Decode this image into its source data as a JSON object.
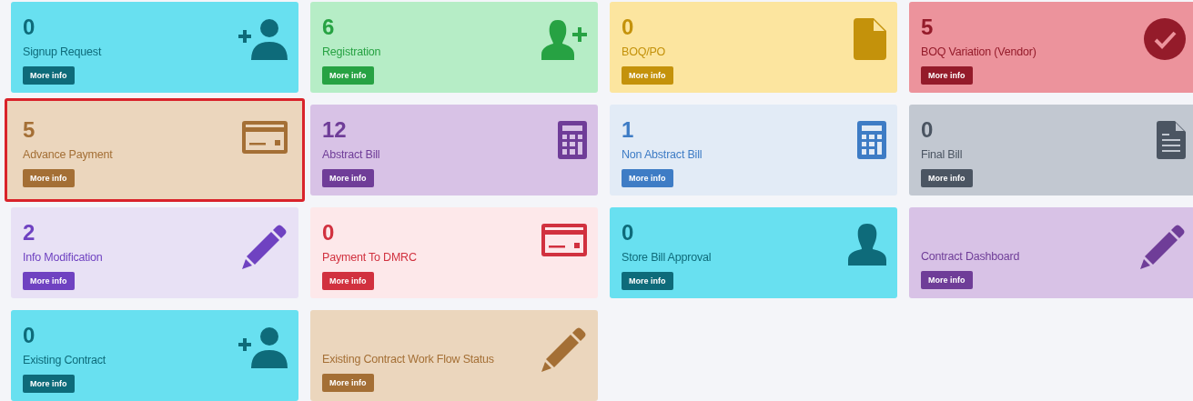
{
  "tiles": [
    {
      "count": "0",
      "label": "Signup Request",
      "button": "More info",
      "color": "#0e6b7a",
      "kind": "user-plus-left",
      "highlighted": false
    },
    {
      "count": "6",
      "label": "Registration",
      "button": "More info",
      "color": "#27a243",
      "kind": "user-plus-right",
      "highlighted": false
    },
    {
      "count": "0",
      "label": "BOQ/PO",
      "button": "More info",
      "color": "#c4920b",
      "kind": "file",
      "highlighted": false
    },
    {
      "count": "5",
      "label": "BOQ Variation (Vendor)",
      "button": "More info",
      "color": "#941b2a",
      "kind": "check-circle",
      "highlighted": false
    },
    {
      "count": "5",
      "label": "Advance Payment",
      "button": "More info",
      "color": "#a46f35",
      "kind": "card",
      "highlighted": true
    },
    {
      "count": "12",
      "label": "Abstract Bill",
      "button": "More info",
      "color": "#6f3d98",
      "kind": "calculator",
      "highlighted": false
    },
    {
      "count": "1",
      "label": "Non Abstract Bill",
      "button": "More info",
      "color": "#3e7cc5",
      "kind": "calculator",
      "highlighted": false
    },
    {
      "count": "0",
      "label": "Final Bill",
      "button": "More info",
      "color": "#4b5562",
      "kind": "document",
      "highlighted": false
    },
    {
      "count": "2",
      "label": "Info Modification",
      "button": "More info",
      "color": "#6f42c1",
      "kind": "pencil",
      "highlighted": false
    },
    {
      "count": "0",
      "label": "Payment To DMRC",
      "button": "More info",
      "color": "#d1313f",
      "kind": "card",
      "highlighted": false
    },
    {
      "count": "0",
      "label": "Store Bill Approval",
      "button": "More info",
      "color": "#0e6b7a",
      "kind": "user",
      "highlighted": false
    },
    {
      "label": "Contract Dashboard",
      "button": "More info",
      "color": "#6f3d98",
      "kind": "pencil",
      "highlighted": false
    },
    {
      "count": "0",
      "label": "Existing Contract",
      "button": "More info",
      "color": "#0e6b7a",
      "kind": "user-plus-left",
      "highlighted": false
    },
    {
      "label": "Existing Contract Work Flow Status",
      "button": "More info",
      "color": "#a46f35",
      "kind": "pencil",
      "highlighted": false
    }
  ]
}
